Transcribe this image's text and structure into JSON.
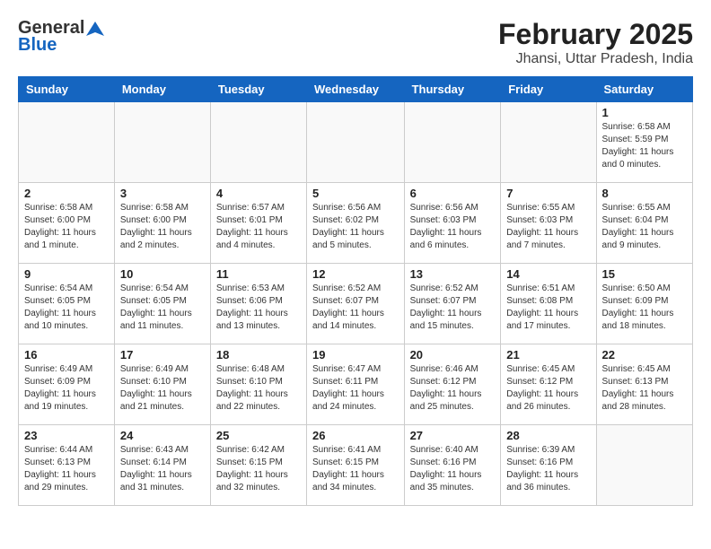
{
  "header": {
    "logo_general": "General",
    "logo_blue": "Blue",
    "month_title": "February 2025",
    "location": "Jhansi, Uttar Pradesh, India"
  },
  "days_of_week": [
    "Sunday",
    "Monday",
    "Tuesday",
    "Wednesday",
    "Thursday",
    "Friday",
    "Saturday"
  ],
  "weeks": [
    [
      {
        "day": "",
        "info": ""
      },
      {
        "day": "",
        "info": ""
      },
      {
        "day": "",
        "info": ""
      },
      {
        "day": "",
        "info": ""
      },
      {
        "day": "",
        "info": ""
      },
      {
        "day": "",
        "info": ""
      },
      {
        "day": "1",
        "info": "Sunrise: 6:58 AM\nSunset: 5:59 PM\nDaylight: 11 hours\nand 0 minutes."
      }
    ],
    [
      {
        "day": "2",
        "info": "Sunrise: 6:58 AM\nSunset: 6:00 PM\nDaylight: 11 hours\nand 1 minute."
      },
      {
        "day": "3",
        "info": "Sunrise: 6:58 AM\nSunset: 6:00 PM\nDaylight: 11 hours\nand 2 minutes."
      },
      {
        "day": "4",
        "info": "Sunrise: 6:57 AM\nSunset: 6:01 PM\nDaylight: 11 hours\nand 4 minutes."
      },
      {
        "day": "5",
        "info": "Sunrise: 6:56 AM\nSunset: 6:02 PM\nDaylight: 11 hours\nand 5 minutes."
      },
      {
        "day": "6",
        "info": "Sunrise: 6:56 AM\nSunset: 6:03 PM\nDaylight: 11 hours\nand 6 minutes."
      },
      {
        "day": "7",
        "info": "Sunrise: 6:55 AM\nSunset: 6:03 PM\nDaylight: 11 hours\nand 7 minutes."
      },
      {
        "day": "8",
        "info": "Sunrise: 6:55 AM\nSunset: 6:04 PM\nDaylight: 11 hours\nand 9 minutes."
      }
    ],
    [
      {
        "day": "9",
        "info": "Sunrise: 6:54 AM\nSunset: 6:05 PM\nDaylight: 11 hours\nand 10 minutes."
      },
      {
        "day": "10",
        "info": "Sunrise: 6:54 AM\nSunset: 6:05 PM\nDaylight: 11 hours\nand 11 minutes."
      },
      {
        "day": "11",
        "info": "Sunrise: 6:53 AM\nSunset: 6:06 PM\nDaylight: 11 hours\nand 13 minutes."
      },
      {
        "day": "12",
        "info": "Sunrise: 6:52 AM\nSunset: 6:07 PM\nDaylight: 11 hours\nand 14 minutes."
      },
      {
        "day": "13",
        "info": "Sunrise: 6:52 AM\nSunset: 6:07 PM\nDaylight: 11 hours\nand 15 minutes."
      },
      {
        "day": "14",
        "info": "Sunrise: 6:51 AM\nSunset: 6:08 PM\nDaylight: 11 hours\nand 17 minutes."
      },
      {
        "day": "15",
        "info": "Sunrise: 6:50 AM\nSunset: 6:09 PM\nDaylight: 11 hours\nand 18 minutes."
      }
    ],
    [
      {
        "day": "16",
        "info": "Sunrise: 6:49 AM\nSunset: 6:09 PM\nDaylight: 11 hours\nand 19 minutes."
      },
      {
        "day": "17",
        "info": "Sunrise: 6:49 AM\nSunset: 6:10 PM\nDaylight: 11 hours\nand 21 minutes."
      },
      {
        "day": "18",
        "info": "Sunrise: 6:48 AM\nSunset: 6:10 PM\nDaylight: 11 hours\nand 22 minutes."
      },
      {
        "day": "19",
        "info": "Sunrise: 6:47 AM\nSunset: 6:11 PM\nDaylight: 11 hours\nand 24 minutes."
      },
      {
        "day": "20",
        "info": "Sunrise: 6:46 AM\nSunset: 6:12 PM\nDaylight: 11 hours\nand 25 minutes."
      },
      {
        "day": "21",
        "info": "Sunrise: 6:45 AM\nSunset: 6:12 PM\nDaylight: 11 hours\nand 26 minutes."
      },
      {
        "day": "22",
        "info": "Sunrise: 6:45 AM\nSunset: 6:13 PM\nDaylight: 11 hours\nand 28 minutes."
      }
    ],
    [
      {
        "day": "23",
        "info": "Sunrise: 6:44 AM\nSunset: 6:13 PM\nDaylight: 11 hours\nand 29 minutes."
      },
      {
        "day": "24",
        "info": "Sunrise: 6:43 AM\nSunset: 6:14 PM\nDaylight: 11 hours\nand 31 minutes."
      },
      {
        "day": "25",
        "info": "Sunrise: 6:42 AM\nSunset: 6:15 PM\nDaylight: 11 hours\nand 32 minutes."
      },
      {
        "day": "26",
        "info": "Sunrise: 6:41 AM\nSunset: 6:15 PM\nDaylight: 11 hours\nand 34 minutes."
      },
      {
        "day": "27",
        "info": "Sunrise: 6:40 AM\nSunset: 6:16 PM\nDaylight: 11 hours\nand 35 minutes."
      },
      {
        "day": "28",
        "info": "Sunrise: 6:39 AM\nSunset: 6:16 PM\nDaylight: 11 hours\nand 36 minutes."
      },
      {
        "day": "",
        "info": ""
      }
    ]
  ]
}
